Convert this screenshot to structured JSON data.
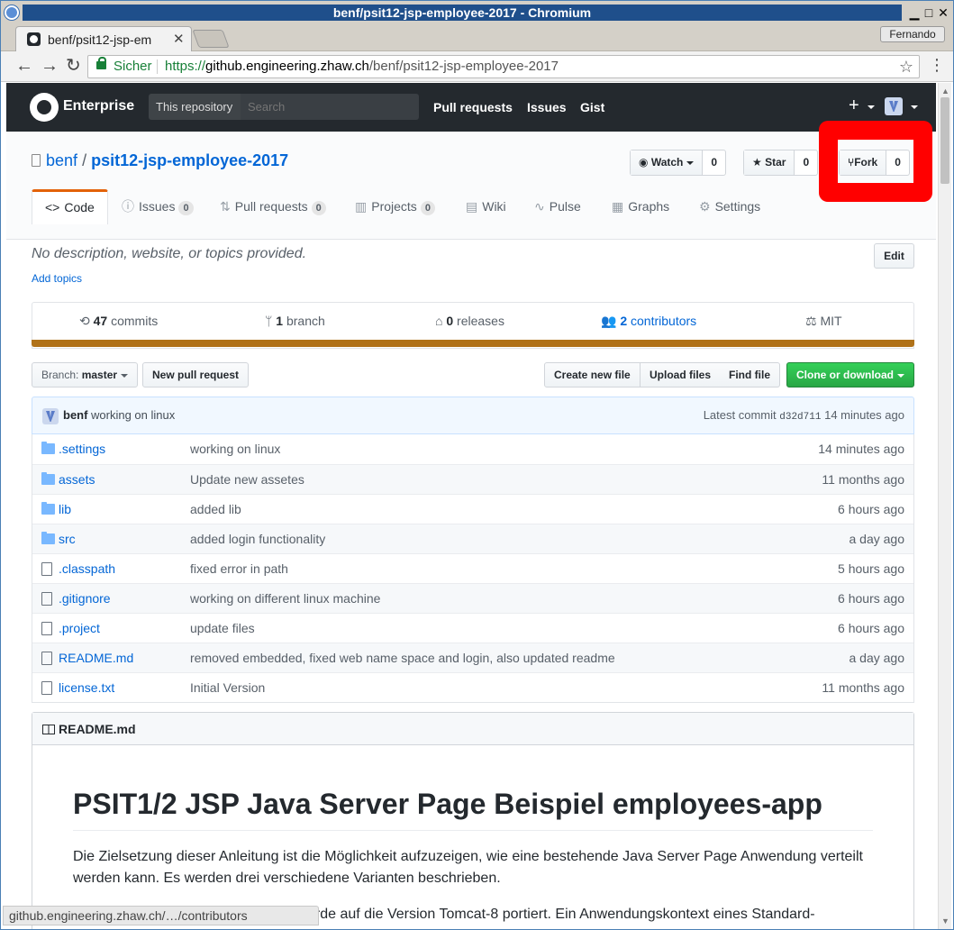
{
  "window": {
    "title": "benf/psit12-jsp-employee-2017 - Chromium",
    "profile": "Fernando"
  },
  "browser": {
    "tab_title": "benf/psit12-jsp-em",
    "secure_label": "Sicher",
    "url_scheme": "https://",
    "url_host": "github.engineering.zhaw.ch",
    "url_path": "/benf/psit12-jsp-employee-2017",
    "status_url": "github.engineering.zhaw.ch/…/contributors"
  },
  "header": {
    "brand": "Enterprise",
    "scope": "This repository",
    "search_placeholder": "Search",
    "nav": [
      "Pull requests",
      "Issues",
      "Gist"
    ]
  },
  "repo": {
    "owner": "benf",
    "name": "psit12-jsp-employee-2017",
    "watch_label": "Watch",
    "watch_count": "0",
    "star_label": "Star",
    "star_count": "0",
    "fork_label": "Fork",
    "fork_count": "0",
    "highlight_color": "#ff0000"
  },
  "tabs": [
    {
      "label": "Code",
      "count": null,
      "icon": "code-icon"
    },
    {
      "label": "Issues",
      "count": "0",
      "icon": "issue-icon"
    },
    {
      "label": "Pull requests",
      "count": "0",
      "icon": "pull-request-icon"
    },
    {
      "label": "Projects",
      "count": "0",
      "icon": "project-icon"
    },
    {
      "label": "Wiki",
      "count": null,
      "icon": "book-icon"
    },
    {
      "label": "Pulse",
      "count": null,
      "icon": "pulse-icon"
    },
    {
      "label": "Graphs",
      "count": null,
      "icon": "graph-icon"
    },
    {
      "label": "Settings",
      "count": null,
      "icon": "gear-icon"
    }
  ],
  "description": {
    "text": "No description, website, or topics provided.",
    "add_topics": "Add topics",
    "edit": "Edit"
  },
  "summary": {
    "commits_num": "47",
    "commits_label": "commits",
    "branch_num": "1",
    "branch_label": "branch",
    "releases_num": "0",
    "releases_label": "releases",
    "contributors_num": "2",
    "contributors_label": "contributors",
    "license": "MIT",
    "language_color": "#b07219"
  },
  "file_nav": {
    "branch_prefix": "Branch:",
    "branch_name": "master",
    "new_pr": "New pull request",
    "create_file": "Create new file",
    "upload_files": "Upload files",
    "find_file": "Find file",
    "clone": "Clone or download"
  },
  "commit": {
    "author": "benf",
    "message": "working on linux",
    "latest_label": "Latest commit",
    "sha": "d32d711",
    "age": "14 minutes ago"
  },
  "files": [
    {
      "type": "dir",
      "name": ".settings",
      "message": "working on linux",
      "age": "14 minutes ago"
    },
    {
      "type": "dir",
      "name": "assets",
      "message": "Update new assetes",
      "age": "11 months ago"
    },
    {
      "type": "dir",
      "name": "lib",
      "message": "added lib",
      "age": "6 hours ago"
    },
    {
      "type": "dir",
      "name": "src",
      "message": "added login functionality",
      "age": "a day ago"
    },
    {
      "type": "file",
      "name": ".classpath",
      "message": "fixed error in path",
      "age": "5 hours ago"
    },
    {
      "type": "file",
      "name": ".gitignore",
      "message": "working on different linux machine",
      "age": "6 hours ago"
    },
    {
      "type": "file",
      "name": ".project",
      "message": "update files",
      "age": "6 hours ago"
    },
    {
      "type": "file",
      "name": "README.md",
      "message": "removed embedded, fixed web name space and login, also updated readme",
      "age": "a day ago"
    },
    {
      "type": "file",
      "name": "license.txt",
      "message": "Initial Version",
      "age": "11 months ago"
    }
  ],
  "readme": {
    "title": "README.md",
    "heading": "PSIT1/2 JSP Java Server Page Beispiel employees-app",
    "paragraph1": "Die Zielsetzung dieser Anleitung ist die Möglichkeit aufzuzeigen, wie eine bestehende Java Server Page Anwendung verteilt werden kann. Es werden drei verschiedene Varianten beschrieben.",
    "paragraph2_visible": "urde auf die Version Tomcat-8 portiert. Ein Anwendungskontext eines Standard-"
  }
}
